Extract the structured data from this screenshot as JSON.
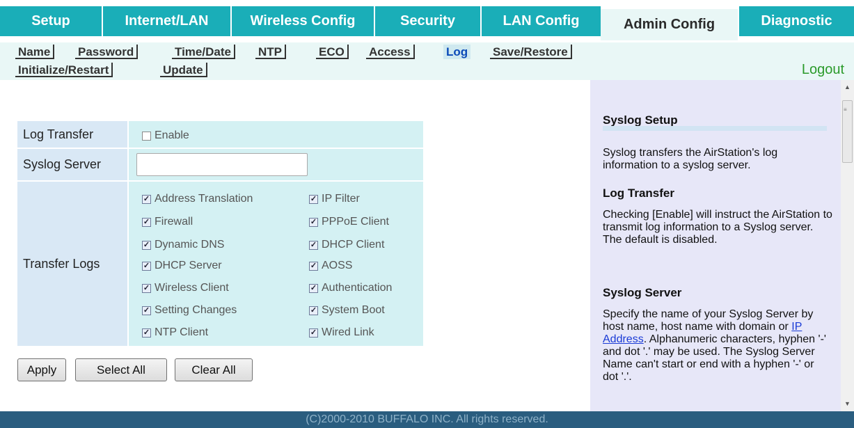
{
  "top_tabs": [
    {
      "label": "Setup"
    },
    {
      "label": "Internet/LAN"
    },
    {
      "label": "Wireless Config"
    },
    {
      "label": "Security"
    },
    {
      "label": "LAN Config"
    },
    {
      "label": "Admin Config"
    },
    {
      "label": "Diagnostic"
    }
  ],
  "sub_tabs": [
    {
      "label": "Name"
    },
    {
      "label": "Password"
    },
    {
      "label": "Time/Date"
    },
    {
      "label": "NTP"
    },
    {
      "label": "ECO"
    },
    {
      "label": "Access"
    },
    {
      "label": "Log"
    },
    {
      "label": "Save/Restore"
    },
    {
      "label": "Initialize/Restart"
    },
    {
      "label": "Update"
    }
  ],
  "logout_label": "Logout",
  "form": {
    "log_transfer_label": "Log Transfer",
    "enable_label": "Enable",
    "syslog_server_label": "Syslog Server",
    "syslog_server_value": "",
    "transfer_logs_label": "Transfer Logs",
    "logs": [
      {
        "label": "Address Translation",
        "checked": true
      },
      {
        "label": "IP Filter",
        "checked": true
      },
      {
        "label": "Firewall",
        "checked": true
      },
      {
        "label": "PPPoE Client",
        "checked": true
      },
      {
        "label": "Dynamic DNS",
        "checked": true
      },
      {
        "label": "DHCP Client",
        "checked": true
      },
      {
        "label": "DHCP Server",
        "checked": true
      },
      {
        "label": "AOSS",
        "checked": true
      },
      {
        "label": "Wireless Client",
        "checked": true
      },
      {
        "label": "Authentication",
        "checked": true
      },
      {
        "label": "Setting Changes",
        "checked": true
      },
      {
        "label": "System Boot",
        "checked": true
      },
      {
        "label": "NTP Client",
        "checked": true
      },
      {
        "label": "Wired Link",
        "checked": true
      }
    ]
  },
  "buttons": {
    "apply": "Apply",
    "select_all": "Select All",
    "clear_all": "Clear All"
  },
  "help": {
    "title": "Syslog Setup",
    "intro": "Syslog transfers the AirStation's log information to a syslog server.",
    "log_transfer_heading": "Log Transfer",
    "log_transfer_text": "Checking [Enable] will instruct the AirStation to transmit log information to a Syslog server. The default is disabled.",
    "syslog_server_heading": "Syslog Server",
    "syslog_server_text_a": "Specify the name of your Syslog Server by host name, host name with domain or ",
    "syslog_server_link": "IP Address",
    "syslog_server_text_b": ". Alphanumeric characters, hyphen '-' and dot '.' may be used. The Syslog Server Name can't start or end with a hyphen '-' or dot '.'."
  },
  "footer": "(C)2000-2010 BUFFALO INC. All rights reserved.",
  "icons": {
    "checkbox_checked": "check-mark",
    "scroll_up": "triangle-up",
    "scroll_down": "triangle-down"
  }
}
